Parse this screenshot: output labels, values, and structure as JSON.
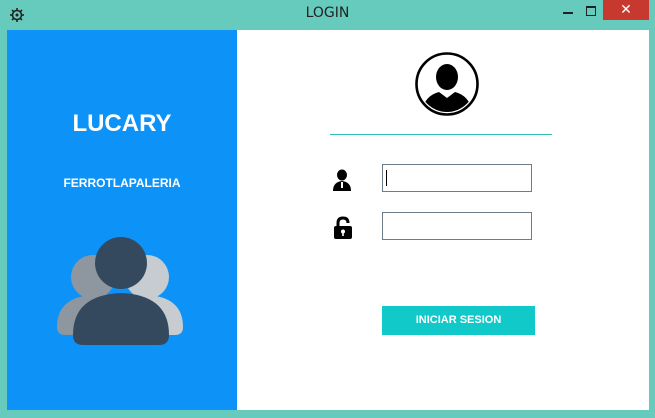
{
  "window": {
    "title": "LOGIN",
    "icons": {
      "app": "gear-icon",
      "minimize": "minimize-icon",
      "maximize": "maximize-icon",
      "close": "close-icon"
    },
    "close_label": "✕"
  },
  "left_panel": {
    "brand": "LUCARY",
    "subtitle": "FERROTLAPALERIA",
    "illustration": "users-group-icon",
    "color": "#0d92f7"
  },
  "form": {
    "avatar_icon": "user-avatar-icon",
    "username": {
      "icon": "user-icon",
      "value": "",
      "placeholder": ""
    },
    "password": {
      "icon": "lock-open-icon",
      "value": "",
      "placeholder": ""
    },
    "submit_label": "INICIAR SESION",
    "accent": "#10c9c8"
  }
}
